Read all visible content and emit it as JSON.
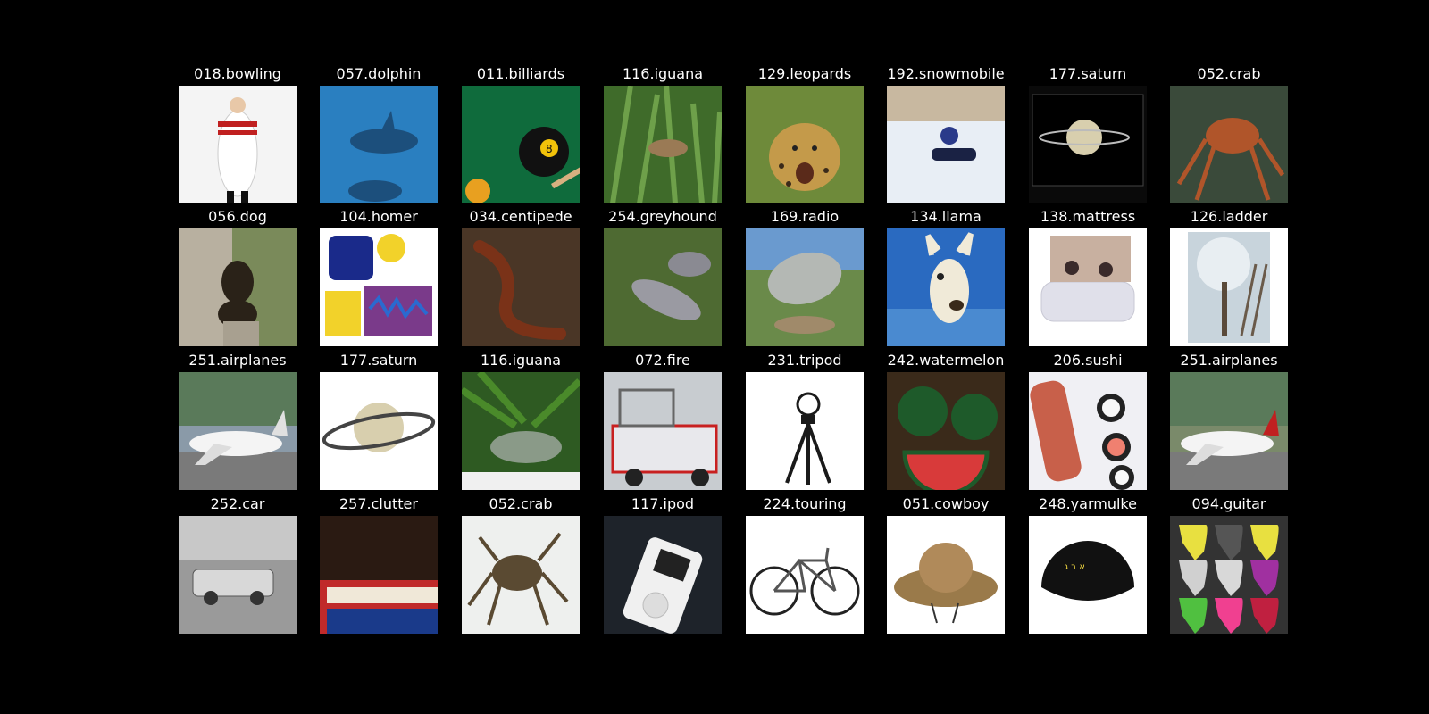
{
  "grid": {
    "columns": 8,
    "rows": 4,
    "background": "#000000",
    "title_color": "#ffffff",
    "items": [
      {
        "label": "018.bowling",
        "subject": "bowling-pin-costume",
        "bg": "#f4f4f4",
        "accent": "#ffffff"
      },
      {
        "label": "057.dolphin",
        "subject": "dolphins",
        "bg": "#2a7fc0",
        "accent": "#1c4f7c"
      },
      {
        "label": "011.billiards",
        "subject": "billiard-ball",
        "bg": "#0f6b3c",
        "accent": "#111111"
      },
      {
        "label": "116.iguana",
        "subject": "iguana-in-grass",
        "bg": "#3f6b2a",
        "accent": "#9a7a55"
      },
      {
        "label": "129.leopards",
        "subject": "cheetah",
        "bg": "#6e8a3a",
        "accent": "#c49a4a"
      },
      {
        "label": "192.snowmobile",
        "subject": "snowmobile",
        "bg": "#e8eef5",
        "accent": "#1a2244"
      },
      {
        "label": "177.saturn",
        "subject": "saturn",
        "bg": "#0a0a0a",
        "accent": "#d8cfae"
      },
      {
        "label": "052.crab",
        "subject": "red-crab",
        "bg": "#3a4a3a",
        "accent": "#b0552a"
      },
      {
        "label": "056.dog",
        "subject": "dog",
        "bg": "#7a8a5a",
        "accent": "#2a2218"
      },
      {
        "label": "104.homer",
        "subject": "cartoon",
        "bg": "#ffffff",
        "accent": "#f2d22a"
      },
      {
        "label": "034.centipede",
        "subject": "centipede",
        "bg": "#4a3626",
        "accent": "#7a3218"
      },
      {
        "label": "254.greyhound",
        "subject": "greyhound",
        "bg": "#4e6a32",
        "accent": "#9a9aa2"
      },
      {
        "label": "169.radio",
        "subject": "satellite-dish",
        "bg": "#6a8a4a",
        "accent": "#b4b8b4"
      },
      {
        "label": "134.llama",
        "subject": "llama",
        "bg": "#2a6ac0",
        "accent": "#f0ead8"
      },
      {
        "label": "138.mattress",
        "subject": "air-mattress",
        "bg": "#ffffff",
        "accent": "#e0e0ea"
      },
      {
        "label": "126.ladder",
        "subject": "tree-ladder",
        "bg": "#ffffff",
        "accent": "#7a8a6a"
      },
      {
        "label": "251.airplanes",
        "subject": "airplane-left",
        "bg": "#8a9aa8",
        "accent": "#f4f4f4"
      },
      {
        "label": "177.saturn",
        "subject": "saturn-large",
        "bg": "#ffffff",
        "accent": "#d8cfae"
      },
      {
        "label": "116.iguana",
        "subject": "iguana-palm",
        "bg": "#2e5a22",
        "accent": "#8a9a88"
      },
      {
        "label": "072.fire",
        "subject": "fire-truck",
        "bg": "#c8ccd0",
        "accent": "#c82020"
      },
      {
        "label": "231.tripod",
        "subject": "tripod",
        "bg": "#ffffff",
        "accent": "#1a1a1a"
      },
      {
        "label": "242.watermelon",
        "subject": "watermelon",
        "bg": "#3a2a1a",
        "accent": "#d83a3a"
      },
      {
        "label": "206.sushi",
        "subject": "sushi",
        "bg": "#f0f0f4",
        "accent": "#c8604a"
      },
      {
        "label": "251.airplanes",
        "subject": "airplane-right",
        "bg": "#7a8a6a",
        "accent": "#f4f4f4"
      },
      {
        "label": "252.car",
        "subject": "car",
        "bg": "#9a9a9a",
        "accent": "#d8d8d8"
      },
      {
        "label": "257.clutter",
        "subject": "clutter",
        "bg": "#2a1a12",
        "accent": "#c02a2a"
      },
      {
        "label": "052.crab",
        "subject": "crab-on-white",
        "bg": "#eef0ee",
        "accent": "#5a4a32"
      },
      {
        "label": "117.ipod",
        "subject": "ipod",
        "bg": "#1e232a",
        "accent": "#f0f0f0"
      },
      {
        "label": "224.touring",
        "subject": "bicycle",
        "bg": "#ffffff",
        "accent": "#555555"
      },
      {
        "label": "051.cowboy",
        "subject": "cowboy-hat",
        "bg": "#ffffff",
        "accent": "#9a7a4a"
      },
      {
        "label": "248.yarmulke",
        "subject": "yarmulke",
        "bg": "#ffffff",
        "accent": "#111111"
      },
      {
        "label": "094.guitar",
        "subject": "guitar-picks",
        "bg": "#333333",
        "accent": "#e8e040"
      }
    ]
  }
}
